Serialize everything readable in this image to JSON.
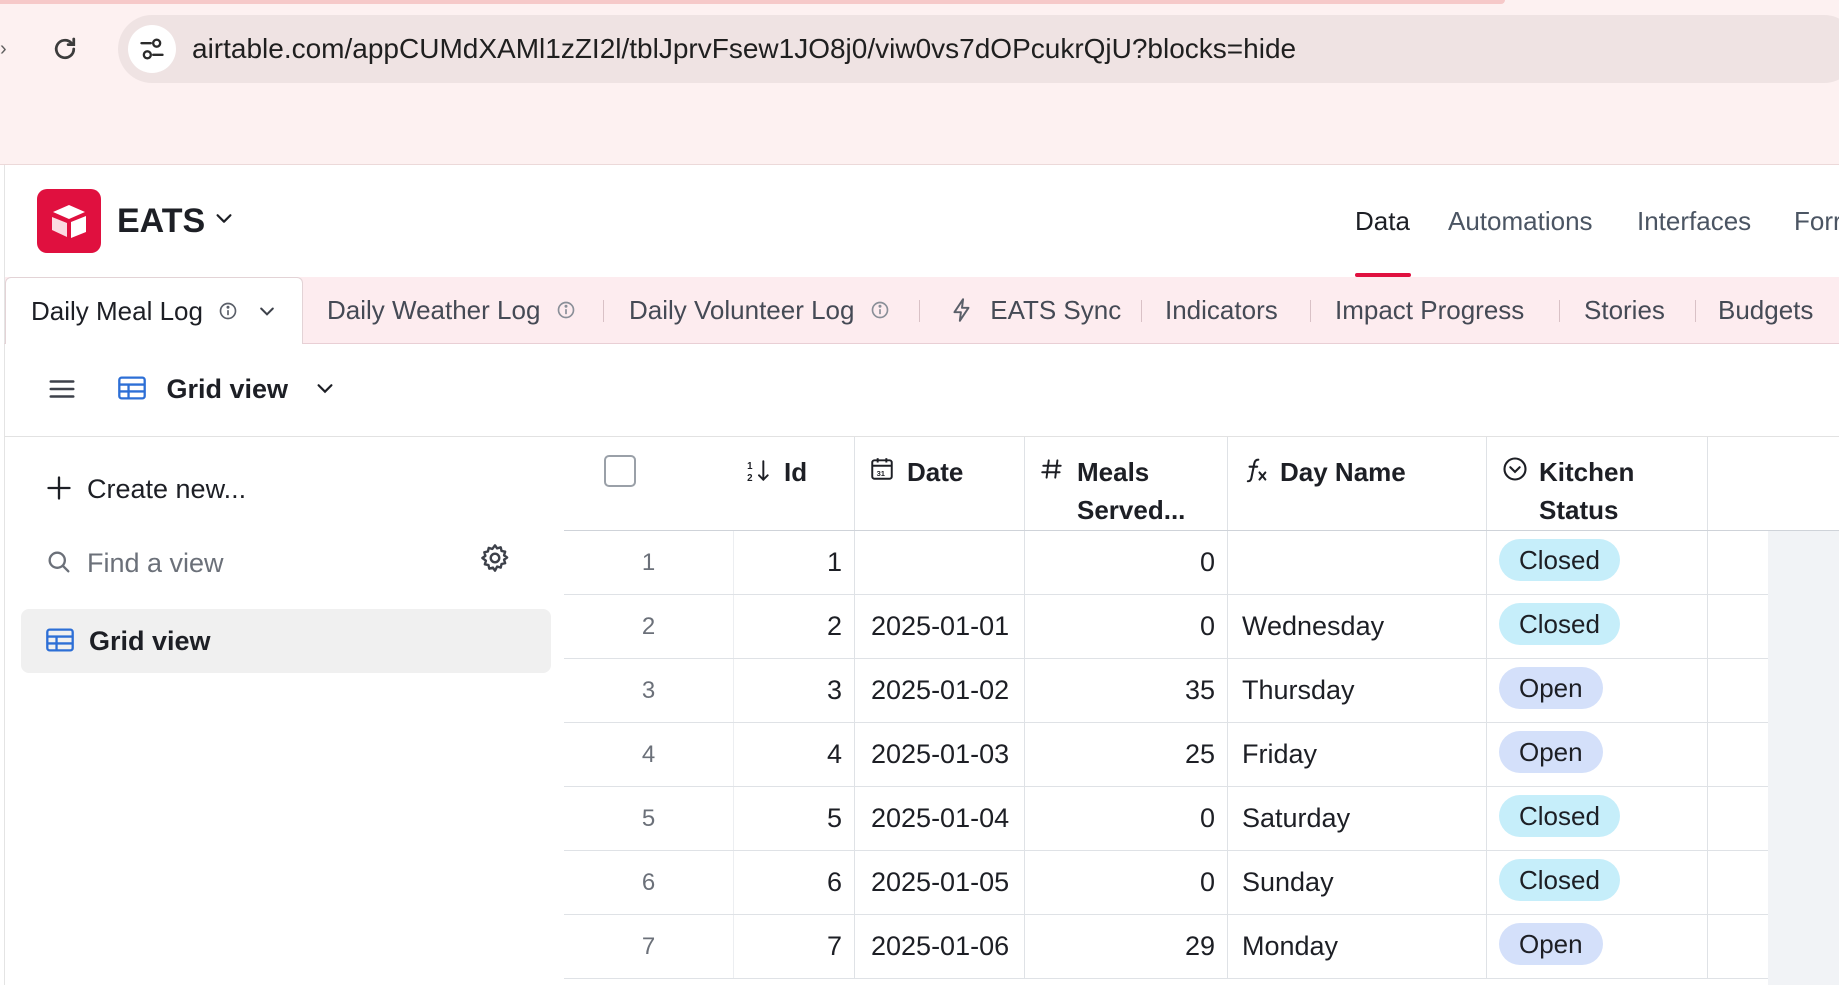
{
  "browser": {
    "url": "airtable.com/appCUMdXAMl1zZI2l/tblJprvFsew1JO8j0/viw0vs7dOPcukrQjU?blocks=hide"
  },
  "app": {
    "base_name": "EATS",
    "brand_color": "#e0103f",
    "nav": {
      "data": "Data",
      "automations": "Automations",
      "interfaces": "Interfaces",
      "forms": "Forr"
    }
  },
  "tabs": {
    "daily_meal_log": "Daily Meal Log",
    "daily_weather_log": "Daily Weather Log",
    "daily_volunteer_log": "Daily Volunteer Log",
    "eats_sync": "EATS Sync",
    "indicators": "Indicators",
    "impact_progress": "Impact Progress",
    "stories": "Stories",
    "budgets": "Budgets"
  },
  "viewbar": {
    "current_view": "Grid view"
  },
  "sidebar": {
    "create_new": "Create new...",
    "find_placeholder": "Find a view",
    "views": [
      "Grid view"
    ]
  },
  "grid": {
    "columns": {
      "id": "Id",
      "date": "Date",
      "meals": "Meals Served...",
      "meals_line1": "Meals",
      "meals_line2": "Served...",
      "day": "Day Name",
      "kitchen_line1": "Kitchen",
      "kitchen_line2": "Status"
    },
    "status_colors": {
      "Closed": "#c6eefa",
      "Open": "#d4e0fa"
    },
    "rows": [
      {
        "n": "1",
        "id": "1",
        "date": "",
        "meals": "0",
        "day": "",
        "status": "Closed"
      },
      {
        "n": "2",
        "id": "2",
        "date": "2025-01-01",
        "meals": "0",
        "day": "Wednesday",
        "status": "Closed"
      },
      {
        "n": "3",
        "id": "3",
        "date": "2025-01-02",
        "meals": "35",
        "day": "Thursday",
        "status": "Open"
      },
      {
        "n": "4",
        "id": "4",
        "date": "2025-01-03",
        "meals": "25",
        "day": "Friday",
        "status": "Open"
      },
      {
        "n": "5",
        "id": "5",
        "date": "2025-01-04",
        "meals": "0",
        "day": "Saturday",
        "status": "Closed"
      },
      {
        "n": "6",
        "id": "6",
        "date": "2025-01-05",
        "meals": "0",
        "day": "Sunday",
        "status": "Closed"
      },
      {
        "n": "7",
        "id": "7",
        "date": "2025-01-06",
        "meals": "29",
        "day": "Monday",
        "status": "Open"
      }
    ]
  }
}
